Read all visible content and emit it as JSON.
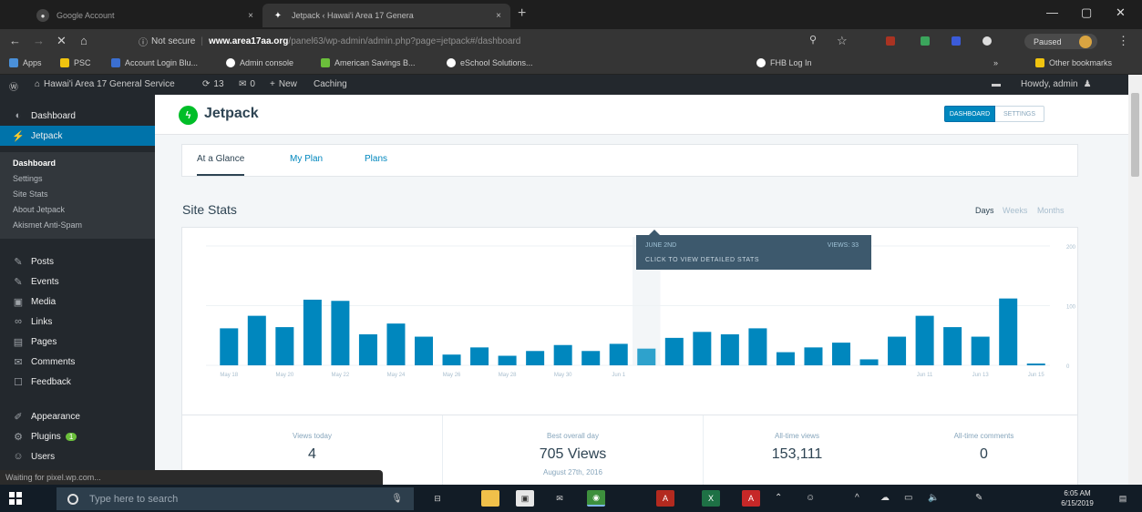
{
  "browser": {
    "tabs": [
      {
        "title": "Google Account",
        "active": false
      },
      {
        "title": "Jetpack ‹ Hawai'i Area 17 Genera",
        "active": true
      }
    ],
    "address": {
      "security": "Not secure",
      "domain": "www.area17aa.org",
      "path": "/panel63/wp-admin/admin.php?page=jetpack#/dashboard"
    },
    "profile_label": "Paused",
    "bookmarks": [
      {
        "label": "Apps",
        "color": "#4a90d9"
      },
      {
        "label": "PSC",
        "color": "#f1c40f"
      },
      {
        "label": "Account Login  Blu...",
        "color": "#3b6fd1"
      },
      {
        "label": "Admin console",
        "color": "#ffffff"
      },
      {
        "label": "American Savings B...",
        "color": "#6bbf3b"
      },
      {
        "label": "eSchool Solutions...",
        "color": "#ffffff"
      },
      {
        "label": "FHB Log In",
        "color": "#ffffff"
      }
    ],
    "other_bookmarks": "Other bookmarks"
  },
  "adminbar": {
    "site": "Hawai'i Area 17 General Service",
    "updates": "13",
    "comments": "0",
    "new": "New",
    "caching": "Caching",
    "howdy": "Howdy, admin"
  },
  "sidebar": {
    "top": [
      {
        "label": "Dashboard",
        "icon": "dashboard-icon",
        "glyph": "◐"
      },
      {
        "label": "Jetpack",
        "icon": "jetpack-icon",
        "glyph": "⚡"
      }
    ],
    "submenu": [
      "Dashboard",
      "Settings",
      "Site Stats",
      "About Jetpack",
      "Akismet Anti-Spam"
    ],
    "items": [
      {
        "label": "Posts",
        "icon": "pin-icon",
        "glyph": "✎"
      },
      {
        "label": "Events",
        "icon": "pin-icon",
        "glyph": "✎"
      },
      {
        "label": "Media",
        "icon": "media-icon",
        "glyph": "▣"
      },
      {
        "label": "Links",
        "icon": "link-icon",
        "glyph": "∞"
      },
      {
        "label": "Pages",
        "icon": "page-icon",
        "glyph": "▤"
      },
      {
        "label": "Comments",
        "icon": "comment-icon",
        "glyph": "✉"
      },
      {
        "label": "Feedback",
        "icon": "feedback-icon",
        "glyph": "☐"
      },
      {
        "label": "Appearance",
        "icon": "brush-icon",
        "glyph": "✐"
      },
      {
        "label": "Plugins",
        "icon": "plugin-icon",
        "glyph": "⚙",
        "badge": "1"
      },
      {
        "label": "Users",
        "icon": "users-icon",
        "glyph": "☺"
      }
    ]
  },
  "status_bar": "Waiting for pixel.wp.com...",
  "jetpack": {
    "title": "Jetpack",
    "btn_dashboard": "DASHBOARD",
    "btn_settings": "SETTINGS",
    "tabs": [
      "At a Glance",
      "My Plan",
      "Plans"
    ],
    "stats_title": "Site Stats",
    "periods": [
      "Days",
      "Weeks",
      "Months"
    ]
  },
  "chart_data": {
    "type": "bar",
    "title": "Site Stats",
    "ylim": [
      0,
      200
    ],
    "yticks": [
      0,
      100,
      200
    ],
    "x_tick_labels": [
      "May 18",
      "May 20",
      "May 22",
      "May 24",
      "May 26",
      "May 28",
      "May 30",
      "Jun 1",
      "Jun 11",
      "Jun 13",
      "Jun 15"
    ],
    "values": [
      62,
      83,
      64,
      110,
      108,
      52,
      70,
      48,
      18,
      30,
      16,
      24,
      34,
      24,
      36,
      28,
      46,
      56,
      52,
      62,
      22,
      30,
      38,
      10,
      48,
      83,
      64,
      48,
      112,
      3
    ],
    "highlight_index": 15,
    "colors": {
      "bar": "#0087be",
      "highlight": "#2ea2cc"
    },
    "tooltip": {
      "date": "JUNE 2ND",
      "views": "VIEWS: 33",
      "cta": "CLICK TO VIEW DETAILED STATS"
    }
  },
  "summary": [
    {
      "label": "Views today",
      "value": "4",
      "sub": ""
    },
    {
      "label": "Best overall day",
      "value": "705 Views",
      "sub": "August 27th, 2016"
    },
    {
      "label": "All-time views",
      "value": "153,111",
      "sub": ""
    },
    {
      "label": "All-time comments",
      "value": "0",
      "sub": ""
    }
  ],
  "taskbar": {
    "search_placeholder": "Type here to search",
    "time": "6:05 AM",
    "date": "6/15/2019"
  }
}
